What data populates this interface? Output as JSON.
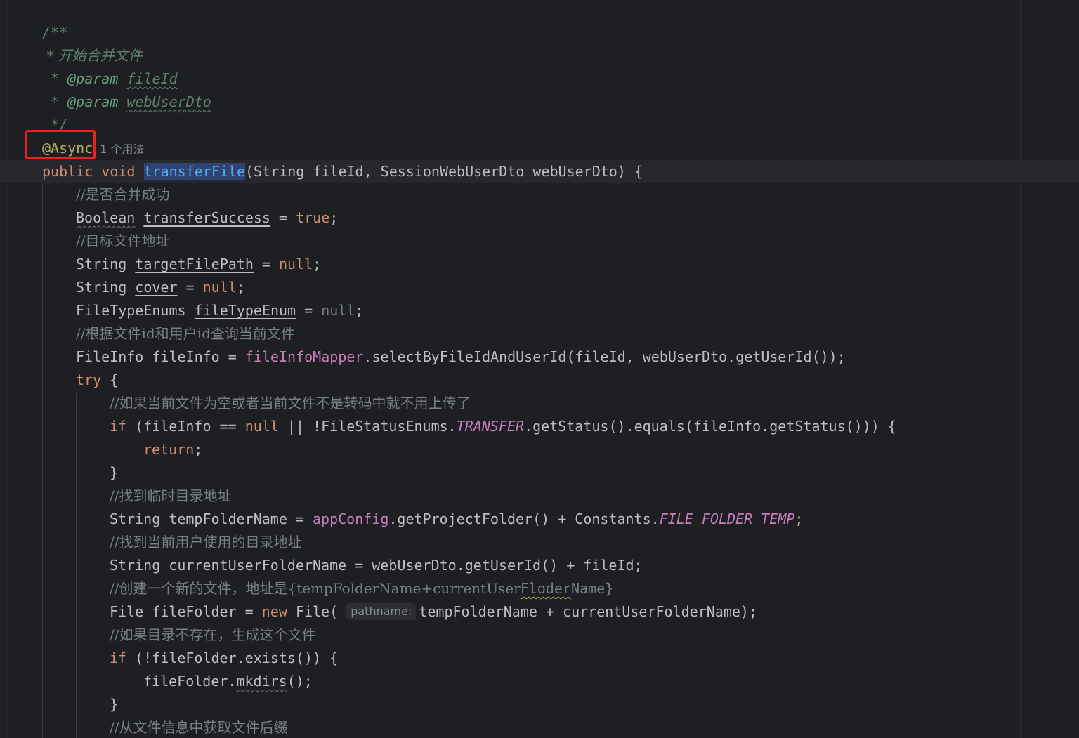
{
  "editor": {
    "doc_comment": {
      "open": "/**",
      "description": " * 开始合并文件",
      "param_tag": "@param",
      "param1": "fileId",
      "param2": "webUserDto",
      "star_prefix": " * ",
      "close": " */"
    },
    "annotation": "@Async",
    "usage_hint": "1 个用法",
    "method_signature": {
      "modifier": "public",
      "return_type": "void",
      "name": "transferFile",
      "params": "(String fileId, SessionWebUserDto webUserDto) {"
    },
    "comments": {
      "merge_success": "//是否合并成功",
      "target_path": "//目标文件地址",
      "query_file": "//根据文件id和用户id查询当前文件",
      "skip_upload": "//如果当前文件为空或者当前文件不是转码中就不用上传了",
      "temp_dir": "//找到临时目录地址",
      "user_dir": "//找到当前用户使用的目录地址",
      "create_file_prefix": "//创建一个新的文件，地址是{tempFolderName+currentUser",
      "create_file_wavy": "Floder",
      "create_file_suffix": "Name}",
      "mkdir": "//如果目录不存在，生成这个文件",
      "suffix": "//从文件信息中获取文件后缀"
    },
    "tokens": {
      "boolean_type": "Boolean",
      "transfer_success": "transferSuccess",
      "true_kw": "true",
      "string_type": "String",
      "target_file_path": "targetFilePath",
      "null_kw": "null",
      "cover": "cover",
      "file_type_enums": "FileTypeEnums",
      "file_type_enum": "fileTypeEnum",
      "file_info_type": "FileInfo",
      "file_info_var": "fileInfo",
      "file_info_mapper": "fileInfoMapper",
      "select_call": ".selectByFileIdAndUserId(fileId, webUserDto.getUserId());",
      "try_kw": "try",
      "if_kw": "if",
      "if_cond_a": "(fileInfo == ",
      "if_cond_b": " || !FileStatusEnums.",
      "transfer_const": "TRANSFER",
      "if_cond_c": ".getStatus().equals(fileInfo.getStatus())) {",
      "return_kw": "return",
      "temp_folder_name": "tempFolderName",
      "app_config": "appConfig",
      "get_project_folder": ".getProjectFolder() + Constants.",
      "file_folder_temp": "FILE_FOLDER_TEMP",
      "current_user_folder": "currentUserFolderName = webUserDto.getUserId() + fileId;",
      "file_type": "File",
      "file_folder": "fileFolder",
      "new_kw": "new",
      "inlay_pathname": "pathname:",
      "new_file_args": "tempFolderName + currentUserFolderName);",
      "exists_call": "(!fileFolder.exists()) {",
      "mkdirs_prefix": "fileFolder.",
      "mkdirs": "mkdirs",
      "mkdirs_suffix": "();",
      "close_brace": "}"
    }
  }
}
